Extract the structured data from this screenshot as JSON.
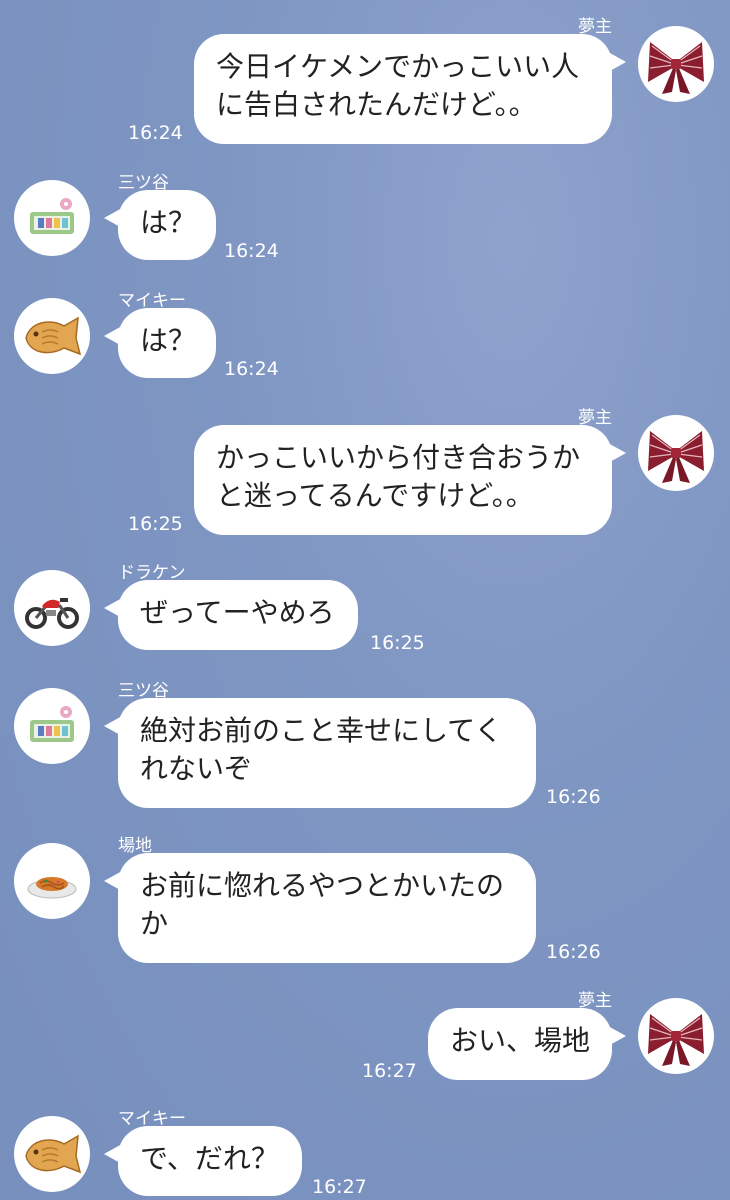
{
  "messages": [
    {
      "side": "right",
      "sender": "夢主",
      "avatar": "ribbon-bow-icon",
      "text": "今日イケメンでかっこいい人\nに告白されたんだけど。。",
      "time": "16:24"
    },
    {
      "side": "left",
      "sender": "三ツ谷",
      "avatar": "sewing-kit-icon",
      "text": "は？",
      "time": "16:24"
    },
    {
      "side": "left",
      "sender": "マイキー",
      "avatar": "taiyaki-icon",
      "text": "は？",
      "time": "16:24"
    },
    {
      "side": "right",
      "sender": "夢主",
      "avatar": "ribbon-bow-icon",
      "text": "かっこいいから付き合おうか\nと迷ってるんですけど。。",
      "time": "16:25"
    },
    {
      "side": "left",
      "sender": "ドラケン",
      "avatar": "motorcycle-icon",
      "text": "ぜってーやめろ",
      "time": "16:25"
    },
    {
      "side": "left",
      "sender": "三ツ谷",
      "avatar": "sewing-kit-icon",
      "text": "絶対お前のこと幸せにしてく\nれないぞ",
      "time": "16:26"
    },
    {
      "side": "left",
      "sender": "場地",
      "avatar": "yakisoba-icon",
      "text": "お前に惚れるやつとかいたの\nか",
      "time": "16:26"
    },
    {
      "side": "right",
      "sender": "夢主",
      "avatar": "ribbon-bow-icon",
      "text": "おい、場地",
      "time": "16:27"
    },
    {
      "side": "left",
      "sender": "マイキー",
      "avatar": "taiyaki-icon",
      "text": "で、だれ？",
      "time": "16:27"
    }
  ]
}
